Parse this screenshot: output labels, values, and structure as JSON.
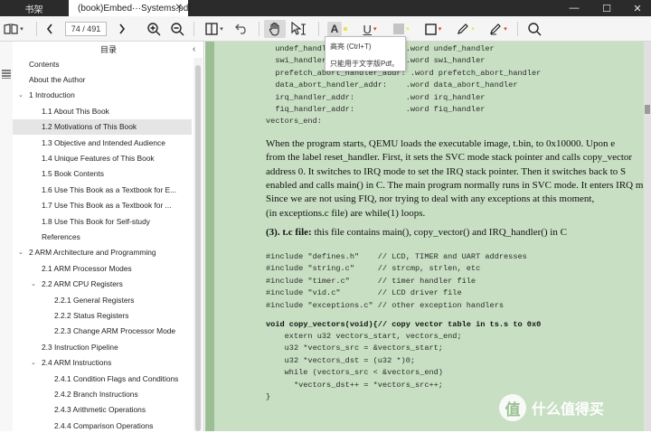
{
  "tabs": {
    "inactive_label": "书架",
    "active_label": "(book)Embed···Systems.pdf",
    "close_glyph": "✕"
  },
  "window_controls": {
    "minimize": "—",
    "maximize": "☐",
    "close": "✕"
  },
  "toolbar": {
    "page_indicator": "74 / 491",
    "icons": [
      "book-icon",
      "prev-page-icon",
      "next-page-icon",
      "zoom-in-icon",
      "zoom-out-icon",
      "layout-icon",
      "undo-icon",
      "hand-icon",
      "text-select-icon",
      "highlight-icon",
      "underline-icon",
      "fill-icon",
      "rectangle-icon",
      "pen-icon",
      "eraser-icon",
      "search-icon"
    ],
    "highlight_letter": "A",
    "underline_letter": "U",
    "accent_red": "#d9342b",
    "highlight_yellow": "#f0e24a"
  },
  "tooltip": {
    "title": "高亮 (Ctrl+T)",
    "note": "只能用于文字版Pdf。"
  },
  "sidebar": {
    "title": "目录",
    "items": [
      {
        "label": "Contents",
        "level": 0,
        "caret": ""
      },
      {
        "label": "About the Author",
        "level": 0,
        "caret": ""
      },
      {
        "label": "1 Introduction",
        "level": 0,
        "caret": "⌄"
      },
      {
        "label": "1.1 About This Book",
        "level": 1,
        "caret": ""
      },
      {
        "label": "1.2 Motivations of This Book",
        "level": 1,
        "caret": "",
        "selected": true
      },
      {
        "label": "1.3 Objective and Intended Audience",
        "level": 1,
        "caret": ""
      },
      {
        "label": "1.4 Unique Features of This Book",
        "level": 1,
        "caret": ""
      },
      {
        "label": "1.5 Book Contents",
        "level": 1,
        "caret": ""
      },
      {
        "label": "1.6 Use This Book as a Textbook for E...",
        "level": 1,
        "caret": ""
      },
      {
        "label": "1.7 Use This Book as a Textbook for ...",
        "level": 1,
        "caret": ""
      },
      {
        "label": "1.8 Use This Book for Self-study",
        "level": 1,
        "caret": ""
      },
      {
        "label": "References",
        "level": 1,
        "caret": ""
      },
      {
        "label": "2 ARM Architecture and Programming",
        "level": 0,
        "caret": "⌄"
      },
      {
        "label": "2.1 ARM Processor Modes",
        "level": 1,
        "caret": ""
      },
      {
        "label": "2.2 ARM CPU Registers",
        "level": 1,
        "caret": "⌄"
      },
      {
        "label": "2.2.1 General Registers",
        "level": 2,
        "caret": ""
      },
      {
        "label": "2.2.2 Status Registers",
        "level": 2,
        "caret": ""
      },
      {
        "label": "2.2.3 Change ARM Processor Mode",
        "level": 2,
        "caret": ""
      },
      {
        "label": "2.3 Instruction Pipeline",
        "level": 1,
        "caret": ""
      },
      {
        "label": "2.4 ARM Instructions",
        "level": 1,
        "caret": "⌄"
      },
      {
        "label": "2.4.1 Condition Flags and Conditions",
        "level": 2,
        "caret": ""
      },
      {
        "label": "2.4.2 Branch Instructions",
        "level": 2,
        "caret": ""
      },
      {
        "label": "2.4.3 Arithmetic Operations",
        "level": 2,
        "caret": ""
      },
      {
        "label": "2.4.4 Comparison Operations",
        "level": 2,
        "caret": ""
      }
    ]
  },
  "document": {
    "code_top": [
      "  undef_handler_addr:         .word undef_handler",
      "  swi_handler_addr:           .word swi_handler",
      "  prefetch_abort_handler_addr: .word prefetch_abort_handler",
      "  data_abort_handler_addr:    .word data_abort_handler",
      "  irq_handler_addr:           .word irq_handler",
      "  fiq_handler_addr:           .word fiq_handler",
      "vectors_end:"
    ],
    "paragraph": [
      "    When the program starts, QEMU loads the executable image, t.bin, to 0x10000. Upon e",
      "from the label reset_handler. First, it sets the SVC mode stack pointer and calls copy_vector",
      "address 0. It switches to IRQ mode to set the IRQ stack pointer. Then it switches back to S",
      "enabled and calls main() in C. The main program normally runs in SVC mode. It enters IRQ m",
      "Since we are not using FIQ, nor trying to deal with any exceptions at this moment,",
      "(in exceptions.c file) are while(1) loops."
    ],
    "section_num": "(3).",
    "section_file": "t.c file:",
    "section_rest": " this file contains main(), copy_vector() and IRQ_handler() in C",
    "includes": [
      "#include \"defines.h\"    // LCD, TIMER and UART addresses",
      "#include \"string.c\"     // strcmp, strlen, etc",
      "#include \"timer.c\"      // timer handler file",
      "#include \"vid.c\"        // LCD driver file",
      "#include \"exceptions.c\" // other exception handlers"
    ],
    "func_sig": "void copy_vectors(void){// copy vector table in ts.s to 0x0",
    "func_body": [
      "    extern u32 vectors_start, vectors_end;",
      "    u32 *vectors_src = &vectors_start;",
      "    u32 *vectors_dst = (u32 *)0;",
      "    while (vectors_src < &vectors_end)",
      "      *vectors_dst++ = *vectors_src++;",
      "}"
    ]
  },
  "watermark": {
    "badge": "值",
    "text": "什么值得买"
  },
  "colors": {
    "page_bg": "#c8dfc3",
    "doc_bg": "#9bbf92",
    "titlebar": "#2b2b2b"
  }
}
